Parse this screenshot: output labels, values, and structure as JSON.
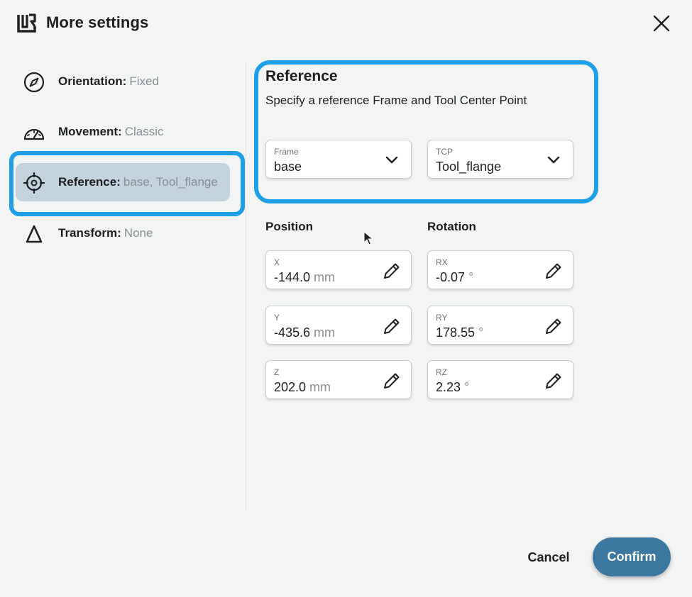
{
  "header": {
    "title": "More settings",
    "logo_icon": "ur-logo-icon",
    "close_icon": "close-icon"
  },
  "sidebar": {
    "items": [
      {
        "key": "Orientation:",
        "value": "Fixed",
        "icon": "compass-icon",
        "active": false
      },
      {
        "key": "Movement:",
        "value": "Classic",
        "icon": "gauge-icon",
        "active": false
      },
      {
        "key": "Reference:",
        "value": "base, Tool_flange",
        "icon": "crosshair-icon",
        "active": true
      },
      {
        "key": "Transform:",
        "value": "None",
        "icon": "delta-icon",
        "active": false
      }
    ]
  },
  "reference": {
    "title": "Reference",
    "subtitle": "Specify a reference Frame and Tool Center Point",
    "frame": {
      "label": "Frame",
      "value": "base"
    },
    "tcp": {
      "label": "TCP",
      "value": "Tool_flange"
    }
  },
  "position": {
    "title": "Position",
    "fields": [
      {
        "label": "X",
        "value": "-144.0",
        "unit": "mm"
      },
      {
        "label": "Y",
        "value": "-435.6",
        "unit": "mm"
      },
      {
        "label": "Z",
        "value": "202.0",
        "unit": "mm"
      }
    ]
  },
  "rotation": {
    "title": "Rotation",
    "fields": [
      {
        "label": "RX",
        "value": "-0.07",
        "unit": "°"
      },
      {
        "label": "RY",
        "value": "178.55",
        "unit": "°"
      },
      {
        "label": "RZ",
        "value": "2.23",
        "unit": "°"
      }
    ]
  },
  "footer": {
    "cancel_label": "Cancel",
    "confirm_label": "Confirm"
  },
  "colors": {
    "background": "#f3f5f5",
    "highlight": "#1ea0e8",
    "active_item": "#c4d3dc",
    "confirm": "#3c77a0"
  }
}
